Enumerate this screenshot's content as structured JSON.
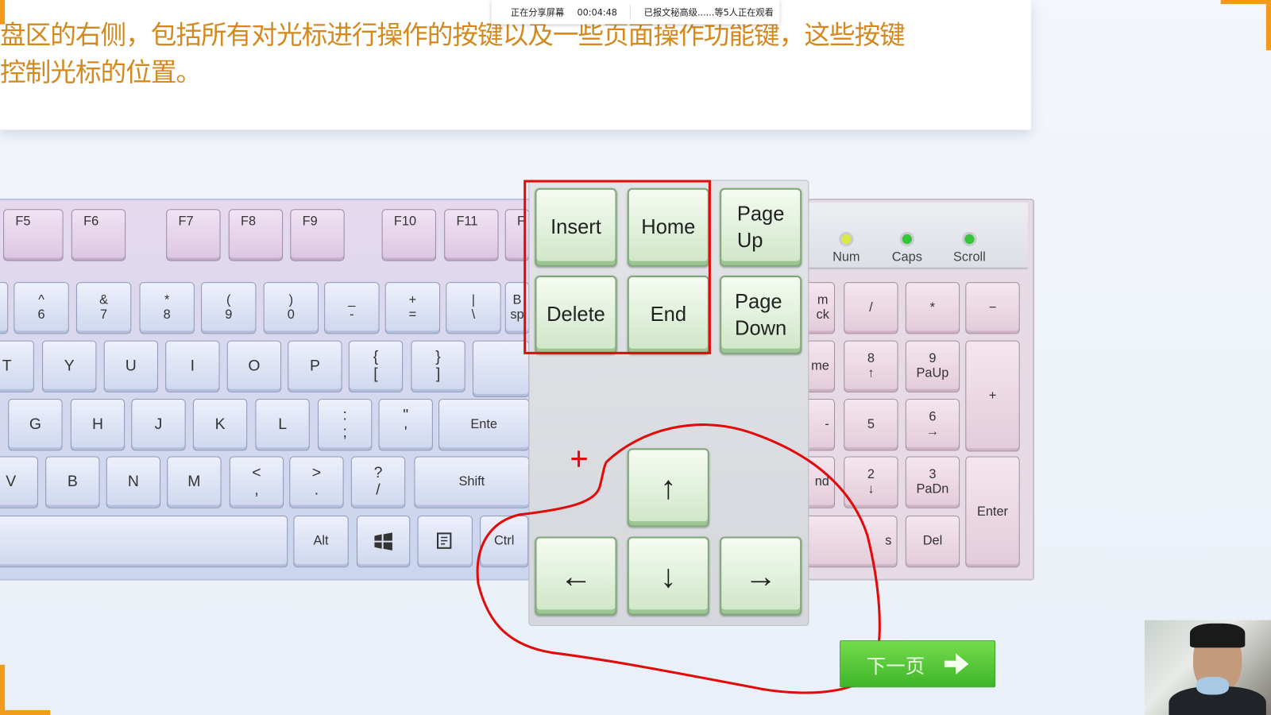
{
  "share_bar": {
    "status": "正在分享屏幕",
    "timer": "00:04:48",
    "viewers": "已报文秘高级......等5人正在观看"
  },
  "lesson": {
    "line1": "盘区的右侧，包括所有对光标进行操作的按键以及一些页面操作功能键，这些按键",
    "line2": "控制光标的位置。"
  },
  "main_keyboard": {
    "function_row": [
      "F5",
      "F6",
      "F7",
      "F8",
      "F9",
      "F10",
      "F11",
      "F"
    ],
    "number_row": [
      "^\n6",
      "&\n7",
      "*\n8",
      "(\n9",
      ")\n0",
      "_\n-",
      "+\n=",
      "|\n\\",
      "B\nsp"
    ],
    "top_row": [
      "T",
      "Y",
      "U",
      "I",
      "O",
      "P",
      "{\n[",
      "}\n]"
    ],
    "home_row": [
      "G",
      "H",
      "J",
      "K",
      "L",
      ":\n;",
      "\"\n'",
      "Ente"
    ],
    "bottom_row": [
      "V",
      "B",
      "N",
      "M",
      "<\n,",
      ">\n.",
      "?\n/",
      "Shift"
    ],
    "modifier_row": [
      "",
      "Alt",
      "",
      "",
      "Ctrl"
    ]
  },
  "edit_keys": {
    "insert": "Insert",
    "home": "Home",
    "page_up": "Page\nUp",
    "delete": "Delete",
    "end": "End",
    "page_down": "Page\nDown"
  },
  "arrow_keys": {
    "up": "↑",
    "left": "←",
    "down": "↓",
    "right": "→"
  },
  "indicators": [
    {
      "label": "Num",
      "color": "#d8e84a"
    },
    {
      "label": "Caps",
      "color": "#35c43a"
    },
    {
      "label": "Scroll",
      "color": "#35c43a"
    }
  ],
  "numpad": {
    "rows": [
      [
        "m\nck",
        "/",
        "*",
        "−"
      ],
      [
        "me",
        "8\n↑",
        "9\nPaUp",
        "+"
      ],
      [
        "-",
        "5",
        "6\n→"
      ],
      [
        "nd",
        "2\n↓",
        "3\nPaDn",
        "Enter"
      ],
      [
        "s",
        "Del"
      ]
    ]
  },
  "next_button": {
    "label": "下一页"
  },
  "colors": {
    "annotation": "#e00c0c",
    "lesson_text": "#d4891e",
    "edit_key": "#cfe6c7",
    "accent": "#f39a1a"
  }
}
